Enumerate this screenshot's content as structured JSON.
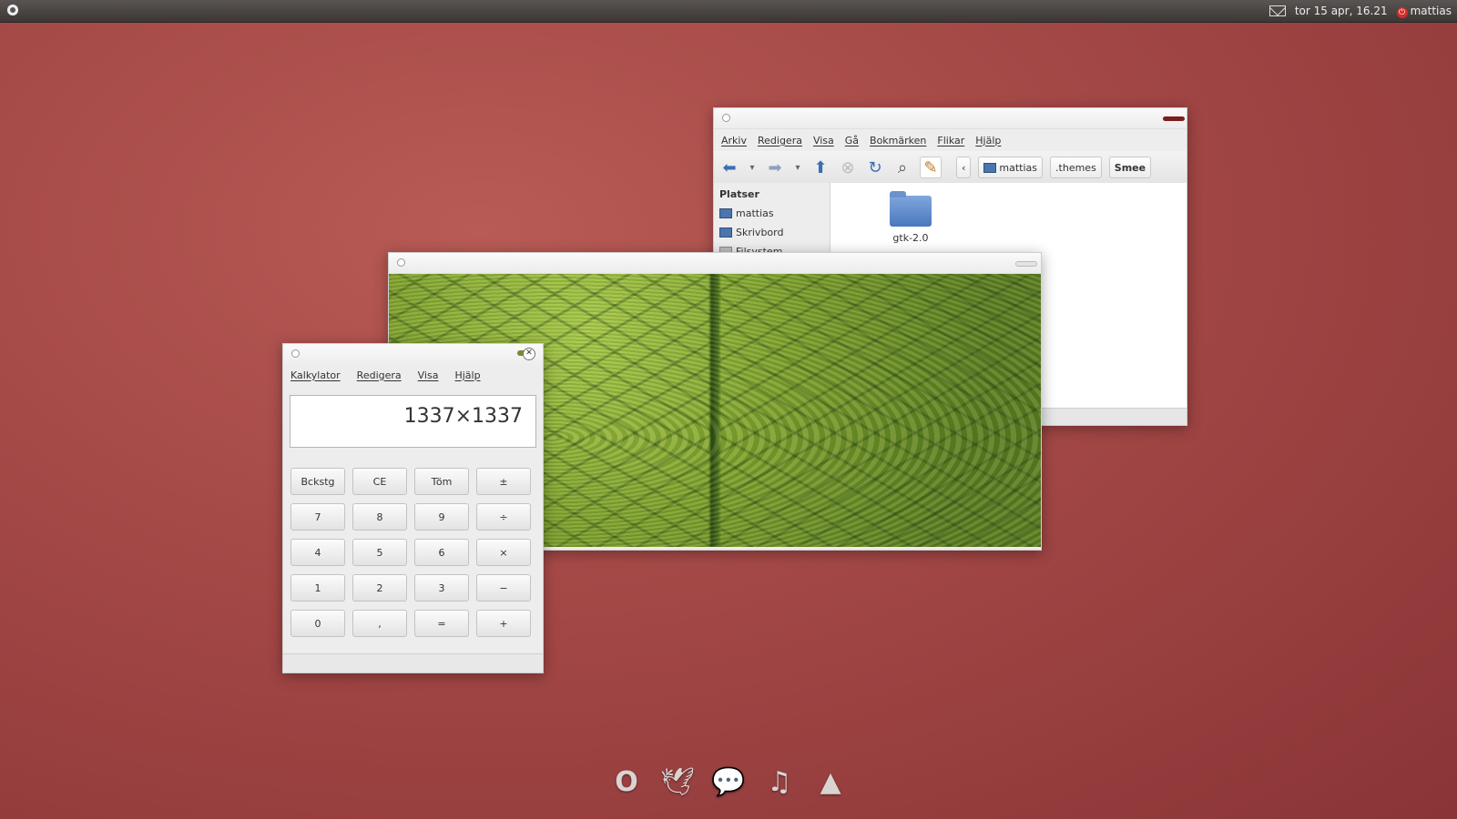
{
  "top_panel": {
    "datetime": "tor 15 apr, 16.21",
    "user": "mattias",
    "icons": [
      "ubuntu-logo-icon",
      "mail-icon",
      "power-icon"
    ]
  },
  "file_manager": {
    "menu": [
      "Arkiv",
      "Redigera",
      "Visa",
      "Gå",
      "Bokmärken",
      "Flikar",
      "Hjälp"
    ],
    "toolbar_icons": [
      "back-icon",
      "dropdown-icon",
      "forward-icon",
      "dropdown-icon",
      "up-icon",
      "stop-icon",
      "reload-icon",
      "search-icon",
      "edit-icon"
    ],
    "breadcrumbs": [
      "mattias",
      ".themes",
      "Smee"
    ],
    "sidebar": {
      "heading": "Platser",
      "items": [
        "mattias",
        "Skrivbord",
        "Filsystem"
      ]
    },
    "files": [
      {
        "name": "gtk-2.0"
      }
    ]
  },
  "image_viewer": {
    "image_desc": "fern leaf"
  },
  "calculator": {
    "menu": [
      "Kalkylator",
      "Redigera",
      "Visa",
      "Hjälp"
    ],
    "display": "1337×1337",
    "keys": [
      [
        "Bckstg",
        "CE",
        "Töm",
        "±"
      ],
      [
        "7",
        "8",
        "9",
        "÷"
      ],
      [
        "4",
        "5",
        "6",
        "×"
      ],
      [
        "1",
        "2",
        "3",
        "−"
      ],
      [
        "0",
        ",",
        "=",
        "+"
      ]
    ]
  },
  "dock": {
    "icons": [
      "opera-icon",
      "bird-icon",
      "chat-icon",
      "music-icon",
      "cone-icon"
    ]
  }
}
